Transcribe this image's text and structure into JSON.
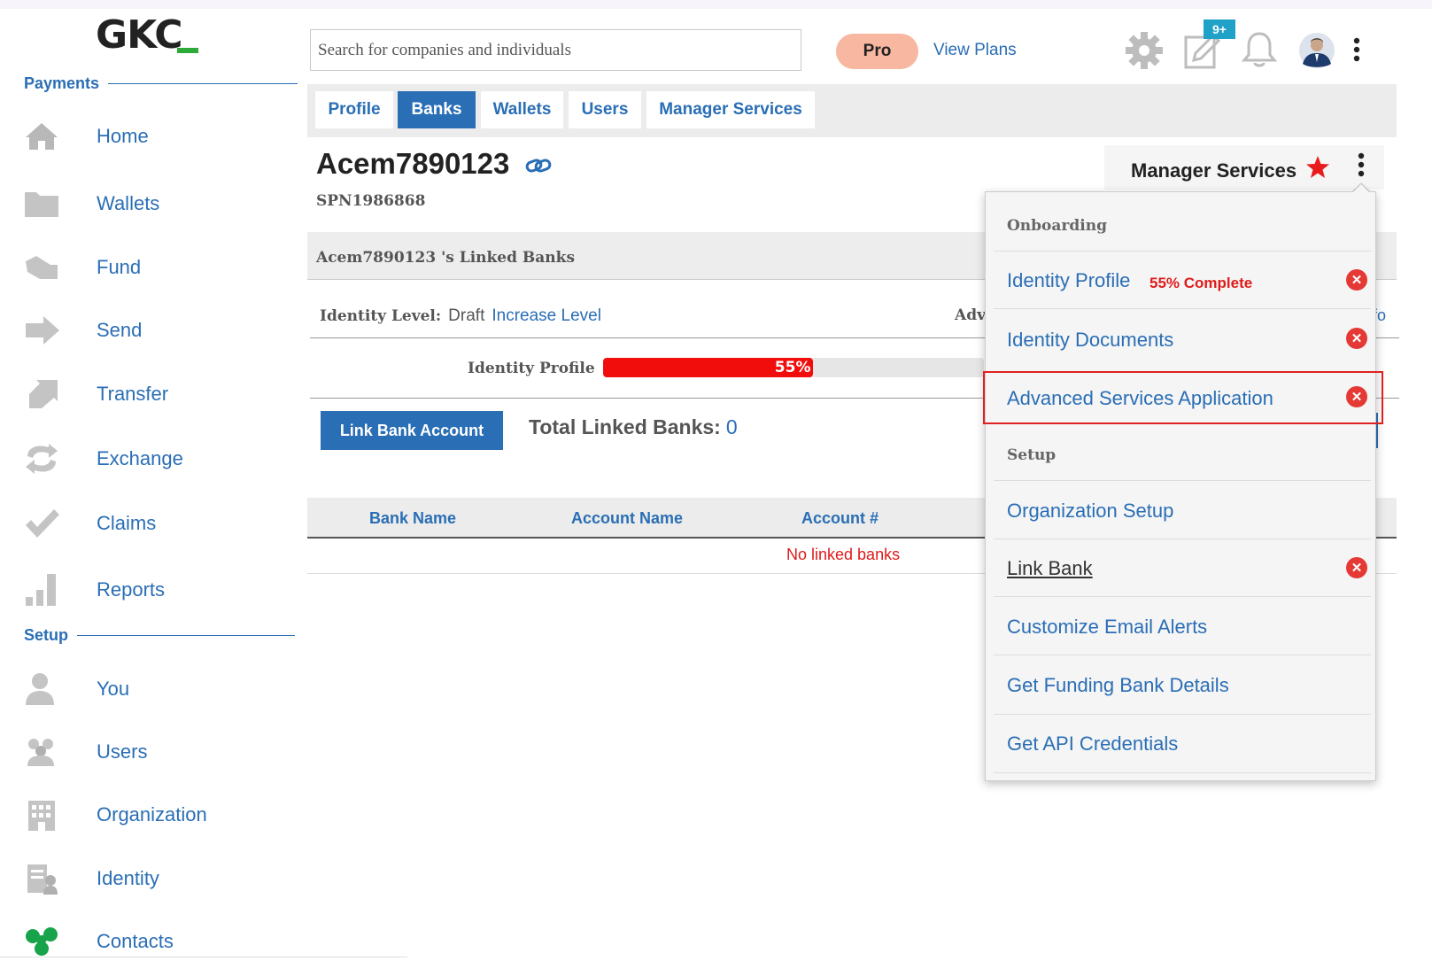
{
  "logo": {
    "text": "GKC"
  },
  "sidebar": {
    "payments_label": "Payments",
    "setup_label": "Setup",
    "payment_items": [
      {
        "label": "Home",
        "icon": "home-icon"
      },
      {
        "label": "Wallets",
        "icon": "folder-icon"
      },
      {
        "label": "Fund",
        "icon": "fund-hand-icon"
      },
      {
        "label": "Send",
        "icon": "send-arrow-icon"
      },
      {
        "label": "Transfer",
        "icon": "transfer-arrow-icon"
      },
      {
        "label": "Exchange",
        "icon": "exchange-icon"
      },
      {
        "label": "Claims",
        "icon": "check-icon"
      },
      {
        "label": "Reports",
        "icon": "bar-chart-icon"
      }
    ],
    "setup_items": [
      {
        "label": "You",
        "icon": "user-icon"
      },
      {
        "label": "Users",
        "icon": "users-icon"
      },
      {
        "label": "Organization",
        "icon": "building-icon"
      },
      {
        "label": "Identity",
        "icon": "identity-icon"
      },
      {
        "label": "Contacts",
        "icon": "contacts-icon"
      }
    ]
  },
  "header": {
    "search_placeholder": "Search for companies and individuals",
    "plan_badge": "Pro",
    "view_plans": "View Plans",
    "notes_badge": "9+"
  },
  "tabs": [
    "Profile",
    "Banks",
    "Wallets",
    "Users",
    "Manager Services"
  ],
  "active_tab": "Banks",
  "account": {
    "name": "Acem7890123",
    "spn": "SPN1986868",
    "linked_title": "Acem7890123 's Linked Banks",
    "identity_level_label": "Identity Level:",
    "identity_level_value": "Draft",
    "increase_level": "Increase Level",
    "adv_cut": "Adv",
    "identity_profile_label": "Identity Profile",
    "identity_progress": 0.55,
    "progress_text": "55%",
    "link_bank_button": "Link Bank Account",
    "total_linked_label": "Total Linked Banks:",
    "total_linked_value": "0"
  },
  "table": {
    "columns": [
      "Bank Name",
      "Account Name",
      "Account #"
    ],
    "empty_message": "No linked banks"
  },
  "manager": {
    "title": "Manager Services",
    "menu": {
      "onboarding_header": "Onboarding",
      "identity_profile": "Identity Profile",
      "identity_profile_status": "55% Complete",
      "identity_documents": "Identity Documents",
      "advanced_services": "Advanced Services Application",
      "setup_header": "Setup",
      "organization_setup": "Organization Setup",
      "link_bank": "Link Bank",
      "customize_email": "Customize Email Alerts",
      "funding_bank": "Get Funding Bank Details",
      "api_credentials": "Get API Credentials"
    },
    "ghost_text": "fo"
  },
  "colors": {
    "accent": "#2a6eb5",
    "danger": "#e53935",
    "progress": "#f20d0d",
    "pro": "#f8b7a0",
    "logo_bar": "#2eaa3b"
  }
}
